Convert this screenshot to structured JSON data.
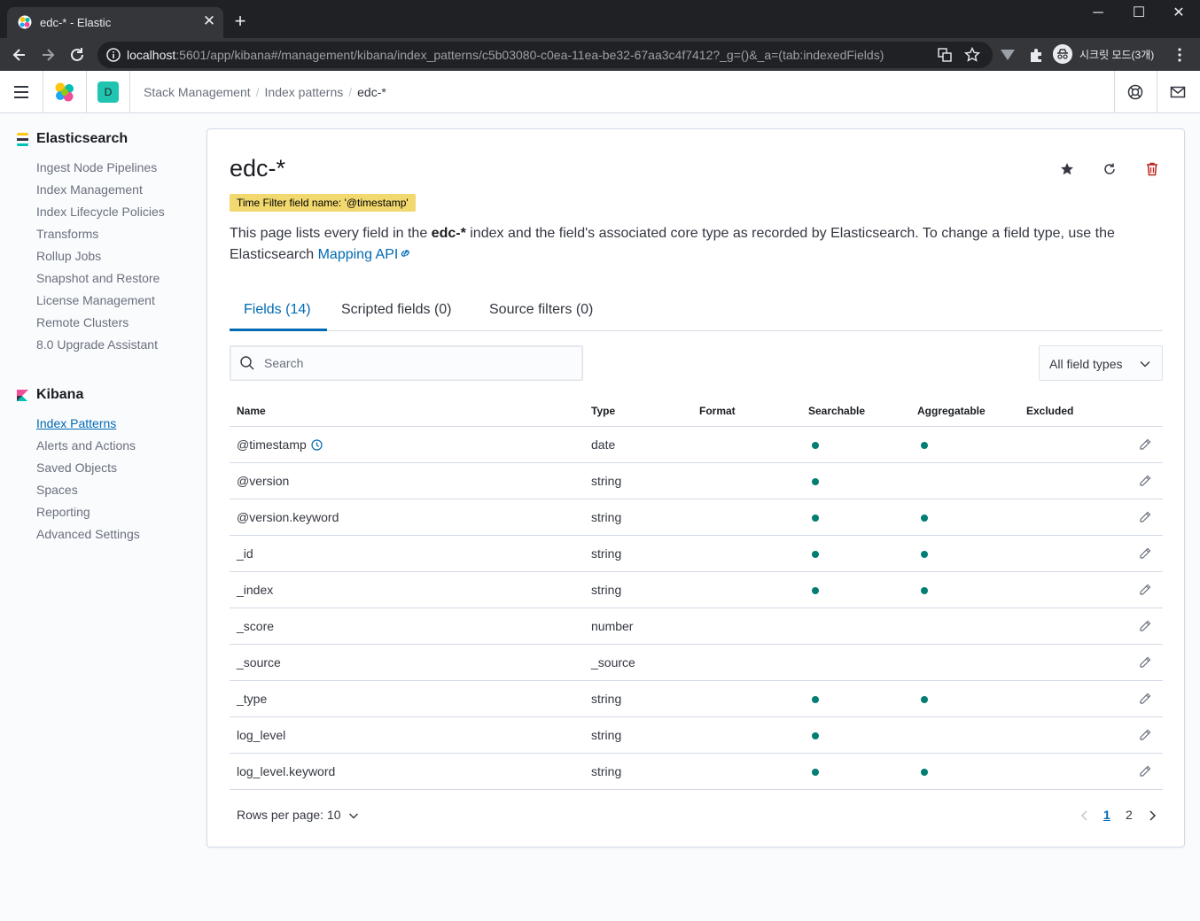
{
  "browser": {
    "tab_title": "edc-* - Elastic",
    "new_tab": "+",
    "url_host": "localhost",
    "url_rest": ":5601/app/kibana#/management/kibana/index_patterns/c5b03080-c0ea-11ea-be32-67aa3c4f7412?_g=()&_a=(tab:indexedFields)",
    "profile_label": "시크릿 모드(3개)",
    "window_minimize": "─",
    "window_maximize": "☐",
    "window_close": "✕"
  },
  "header": {
    "space_initial": "D",
    "breadcrumbs": [
      "Stack Management",
      "Index patterns",
      "edc-*"
    ]
  },
  "sidebar": {
    "elasticsearch": {
      "title": "Elasticsearch",
      "items": [
        "Ingest Node Pipelines",
        "Index Management",
        "Index Lifecycle Policies",
        "Transforms",
        "Rollup Jobs",
        "Snapshot and Restore",
        "License Management",
        "Remote Clusters",
        "8.0 Upgrade Assistant"
      ]
    },
    "kibana": {
      "title": "Kibana",
      "items": [
        "Index Patterns",
        "Alerts and Actions",
        "Saved Objects",
        "Spaces",
        "Reporting",
        "Advanced Settings"
      ]
    }
  },
  "page": {
    "title": "edc-*",
    "time_filter_badge": "Time Filter field name: '@timestamp'",
    "desc_pre": "This page lists every field in the ",
    "desc_bold": "edc-*",
    "desc_mid": " index and the field's associated core type as recorded by Elasticsearch. To change a field type, use the Elasticsearch ",
    "desc_link": "Mapping API",
    "tabs": [
      "Fields (14)",
      "Scripted fields (0)",
      "Source filters (0)"
    ],
    "search_placeholder": "Search",
    "field_type_filter": "All field types",
    "columns": [
      "Name",
      "Type",
      "Format",
      "Searchable",
      "Aggregatable",
      "Excluded"
    ],
    "rows": [
      {
        "name": "@timestamp",
        "type": "date",
        "searchable": true,
        "aggregatable": true,
        "time": true
      },
      {
        "name": "@version",
        "type": "string",
        "searchable": true,
        "aggregatable": false
      },
      {
        "name": "@version.keyword",
        "type": "string",
        "searchable": true,
        "aggregatable": true
      },
      {
        "name": "_id",
        "type": "string",
        "searchable": true,
        "aggregatable": true
      },
      {
        "name": "_index",
        "type": "string",
        "searchable": true,
        "aggregatable": true
      },
      {
        "name": "_score",
        "type": "number",
        "searchable": false,
        "aggregatable": false
      },
      {
        "name": "_source",
        "type": "_source",
        "searchable": false,
        "aggregatable": false
      },
      {
        "name": "_type",
        "type": "string",
        "searchable": true,
        "aggregatable": true
      },
      {
        "name": "log_level",
        "type": "string",
        "searchable": true,
        "aggregatable": false
      },
      {
        "name": "log_level.keyword",
        "type": "string",
        "searchable": true,
        "aggregatable": true
      }
    ],
    "rows_per_page": "Rows per page: 10",
    "pages": [
      "1",
      "2"
    ],
    "current_page": "1"
  },
  "colors": {
    "accent": "#006bb4",
    "dot": "#017d73",
    "badge": "#f1d86f",
    "delete": "#bd271e"
  }
}
